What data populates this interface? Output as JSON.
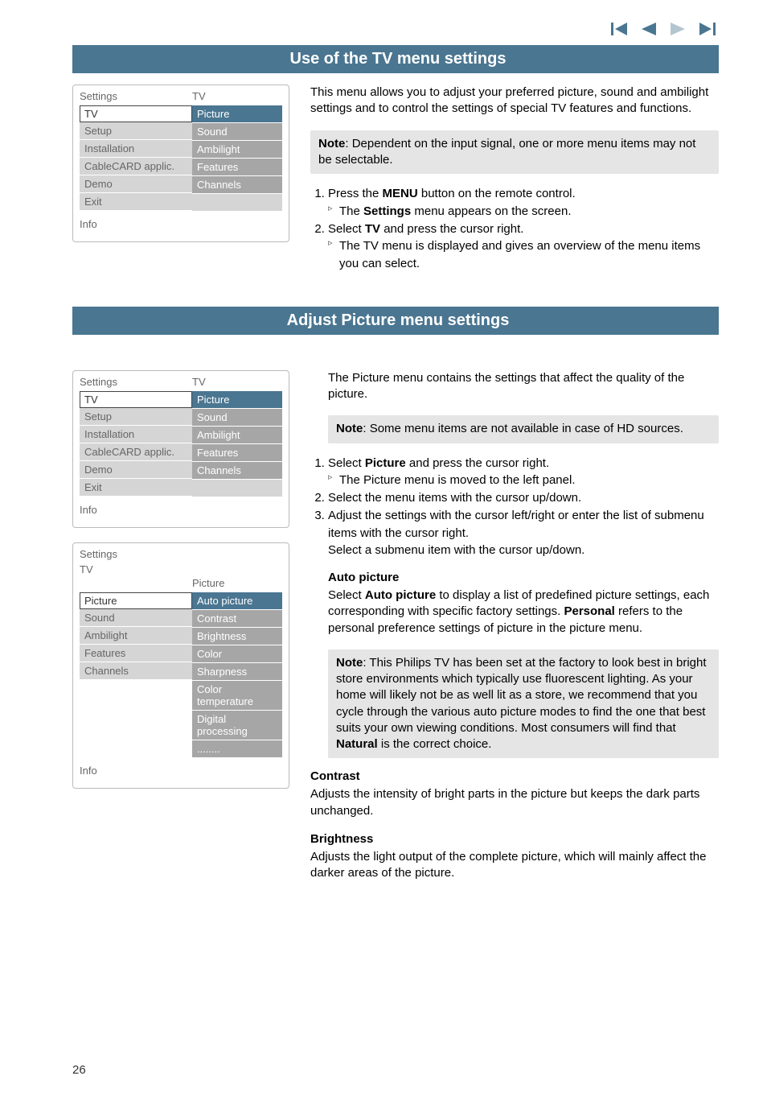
{
  "nav_icons": {
    "first": "first-icon",
    "prev": "prev-icon",
    "play": "play-icon",
    "last": "last-icon"
  },
  "section1": {
    "title": "Use of the TV menu settings",
    "menu": {
      "left_header": "Settings",
      "right_header": "TV",
      "left_items": [
        "TV",
        "Setup",
        "Installation",
        "CableCARD applic.",
        "Demo",
        "Exit"
      ],
      "right_items": [
        "Picture",
        "Sound",
        "Ambilight",
        "Features",
        "Channels"
      ],
      "info": "Info"
    },
    "intro": "This menu allows you to adjust your preferred picture, sound and ambilight settings and to control the settings of special TV features and functions.",
    "note": "Dependent on the input signal, one or more menu items may  not be selectable.",
    "note_label": "Note",
    "steps": {
      "s1": "Press the ",
      "s1_bold": "MENU",
      "s1_tail": " button on the remote control.",
      "s1_sub_a": "The ",
      "s1_sub_bold": "Settings",
      "s1_sub_b": " menu appears on the screen.",
      "s2": "Select ",
      "s2_bold": "TV",
      "s2_tail": " and press the cursor right.",
      "s2_sub": "The TV menu is displayed and gives an overview of the menu items you can select."
    }
  },
  "section2": {
    "title": "Adjust Picture menu settings",
    "menu1": {
      "left_header": "Settings",
      "right_header": "TV",
      "left_items": [
        "TV",
        "Setup",
        "Installation",
        "CableCARD applic.",
        "Demo",
        "Exit"
      ],
      "right_items": [
        "Picture",
        "Sound",
        "Ambilight",
        "Features",
        "Channels"
      ],
      "info": "Info"
    },
    "menu2": {
      "left_header": "Settings",
      "left_sel": "TV",
      "right_header": "Picture",
      "left_items": [
        "Picture",
        "Sound",
        "Ambilight",
        "Features",
        "Channels"
      ],
      "right_items": [
        "Auto picture",
        "Contrast",
        "Brightness",
        "Color",
        "Sharpness",
        "Color temperature",
        "Digital processing",
        "........"
      ],
      "info": "Info"
    },
    "intro": "The Picture menu contains the settings that affect the quality of the picture.",
    "note_label": "Note",
    "note": "Some menu items are not available in case of HD sources.",
    "steps": {
      "s1a": "Select ",
      "s1bold": "Picture",
      "s1b": " and press the cursor right.",
      "s1_sub": "The Picture menu is moved to the left panel.",
      "s2": "Select the menu items with the cursor up/down.",
      "s3": "Adjust the settings with the cursor left/right or enter the list of submenu items with the cursor right.",
      "s3_extra": "Select a submenu item with the cursor up/down."
    },
    "auto_picture": {
      "heading": "Auto picture",
      "p_a": "Select ",
      "p_bold1": "Auto picture",
      "p_b": " to display a list of predefined picture settings, each corresponding with specific factory settings. ",
      "p_bold2": "Personal",
      "p_c": " refers to the personal preference settings of picture in the picture menu.",
      "note_a": "This Philips TV has been set at the factory to look best in bright store environments which typically use fluorescent lighting. As your home will likely not be as well lit as a store, we recommend that you cycle through the various auto picture modes to find the one that best suits your own viewing conditions. Most consumers will find that ",
      "note_bold": "Natural",
      "note_b": " is the correct choice."
    },
    "contrast": {
      "heading": "Contrast",
      "para": "Adjusts the intensity of bright parts in the picture but keeps the dark parts unchanged."
    },
    "brightness": {
      "heading": "Brightness",
      "para": "Adjusts the light output of the complete picture, which will mainly affect the darker areas of the picture."
    }
  },
  "page_number": "26"
}
